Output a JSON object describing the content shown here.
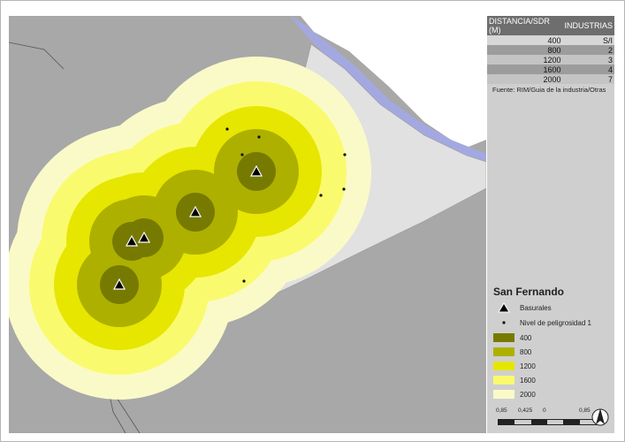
{
  "industry_table": {
    "header_distance": "DISTANCIA/SDR (M)",
    "header_industries": "INDUSTRIAS",
    "rows": [
      {
        "distance": "400",
        "count": "S/I"
      },
      {
        "distance": "800",
        "count": "2"
      },
      {
        "distance": "1200",
        "count": "3"
      },
      {
        "distance": "1600",
        "count": "4"
      },
      {
        "distance": "2000",
        "count": "7"
      }
    ]
  },
  "source_note": "Fuente: RIM/Guia de la industria/Otras",
  "legend": {
    "title": "San Fernando",
    "dumps_label": "Basurales",
    "hazard_label": "Nivel de peligrosidad 1",
    "buffers": [
      {
        "label": "400",
        "color": "#777a00"
      },
      {
        "label": "800",
        "color": "#aeb000"
      },
      {
        "label": "1200",
        "color": "#e6e600"
      },
      {
        "label": "1600",
        "color": "#fafa6e"
      },
      {
        "label": "2000",
        "color": "#fafac8"
      }
    ]
  },
  "scale": {
    "labels": [
      "0,85",
      "0,425",
      "0",
      "0,85"
    ]
  },
  "colors": {
    "land": "#a8a8a8",
    "municipality": "#e1e1e1",
    "water": "#a3a9e0",
    "panel": "#cfcfcf",
    "header": "#6e6e6e"
  },
  "icons": {
    "dump": "triangle-icon",
    "industry": "dot-icon",
    "north": "north-arrow-icon"
  }
}
